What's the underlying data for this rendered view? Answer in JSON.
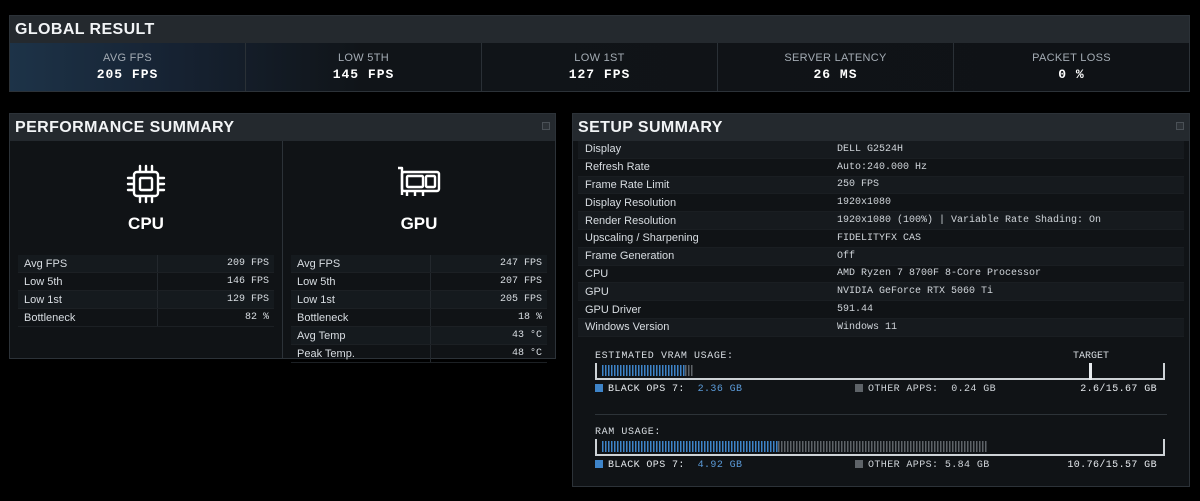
{
  "global": {
    "title": "GLOBAL RESULT",
    "metrics": [
      {
        "label": "AVG FPS",
        "value": "205 FPS"
      },
      {
        "label": "LOW 5TH",
        "value": "145 FPS"
      },
      {
        "label": "LOW 1ST",
        "value": "127 FPS"
      },
      {
        "label": "SERVER LATENCY",
        "value": "26 MS"
      },
      {
        "label": "PACKET LOSS",
        "value": "0 %"
      }
    ]
  },
  "performance": {
    "title": "PERFORMANCE SUMMARY",
    "cpu": {
      "label": "CPU",
      "icon": "cpu-chip-icon",
      "stats": [
        {
          "label": "Avg FPS",
          "value": "209 FPS"
        },
        {
          "label": "Low 5th",
          "value": "146 FPS"
        },
        {
          "label": "Low 1st",
          "value": "129 FPS"
        },
        {
          "label": "Bottleneck",
          "value": "82 %"
        }
      ]
    },
    "gpu": {
      "label": "GPU",
      "icon": "graphics-card-icon",
      "stats": [
        {
          "label": "Avg FPS",
          "value": "247 FPS"
        },
        {
          "label": "Low 5th",
          "value": "207 FPS"
        },
        {
          "label": "Low 1st",
          "value": "205 FPS"
        },
        {
          "label": "Bottleneck",
          "value": "18 %"
        },
        {
          "label": "Avg Temp",
          "value": "43 °C"
        },
        {
          "label": "Peak Temp.",
          "value": "48 °C"
        }
      ]
    }
  },
  "setup": {
    "title": "SETUP SUMMARY",
    "rows": [
      {
        "key": "Display",
        "value": "DELL G2524H"
      },
      {
        "key": "Refresh Rate",
        "value": "Auto:240.000 Hz"
      },
      {
        "key": "Frame Rate Limit",
        "value": "250 FPS"
      },
      {
        "key": "Display Resolution",
        "value": "1920x1080"
      },
      {
        "key": "Render Resolution",
        "value": "1920x1080 (100%) | Variable Rate Shading: On"
      },
      {
        "key": "Upscaling / Sharpening",
        "value": "FIDELITYFX CAS"
      },
      {
        "key": "Frame Generation",
        "value": "Off"
      },
      {
        "key": "CPU",
        "value": "AMD Ryzen 7 8700F 8-Core Processor"
      },
      {
        "key": "GPU",
        "value": "NVIDIA GeForce RTX 5060 Ti"
      },
      {
        "key": "GPU Driver",
        "value": "591.44"
      },
      {
        "key": "Windows Version",
        "value": "Windows 11"
      }
    ],
    "vram": {
      "title": "ESTIMATED VRAM USAGE:",
      "target_label": "TARGET",
      "game_label": "BLACK OPS 7:",
      "game_value": "2.36 GB",
      "game_fraction": 0.15,
      "other_label": "OTHER APPS:",
      "other_value": "0.24 GB",
      "other_fraction": 0.015,
      "target_fraction": 0.87,
      "total": "2.6/15.67 GB"
    },
    "ram": {
      "title": "RAM USAGE:",
      "game_label": "BLACK OPS 7:",
      "game_value": "4.92 GB",
      "game_fraction": 0.316,
      "other_label": "OTHER APPS:",
      "other_value": "5.84 GB",
      "other_fraction": 0.375,
      "total": "10.76/15.57 GB"
    },
    "colors": {
      "game": "#3e84c9",
      "other": "#5e6368"
    }
  }
}
